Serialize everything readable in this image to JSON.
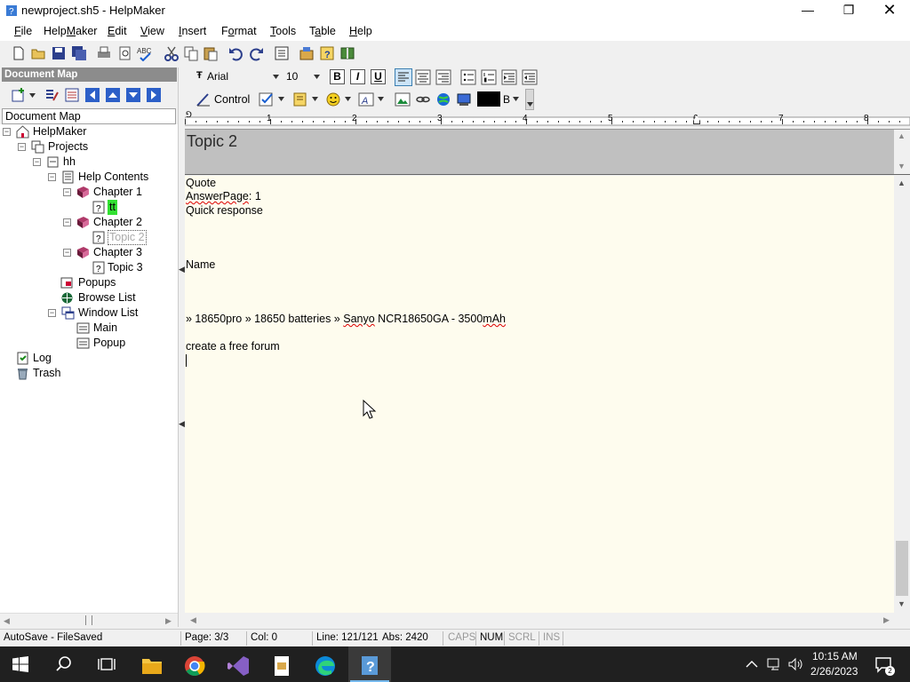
{
  "window": {
    "title": "newproject.sh5 - HelpMaker"
  },
  "menu": {
    "items": [
      {
        "pre": "",
        "acc": "F",
        "post": "ile"
      },
      {
        "pre": "Help",
        "acc": "M",
        "post": "aker"
      },
      {
        "pre": "",
        "acc": "E",
        "post": "dit"
      },
      {
        "pre": "",
        "acc": "V",
        "post": "iew"
      },
      {
        "pre": "",
        "acc": "I",
        "post": "nsert"
      },
      {
        "pre": "F",
        "acc": "o",
        "post": "rmat"
      },
      {
        "pre": "",
        "acc": "T",
        "post": "ools"
      },
      {
        "pre": "T",
        "acc": "a",
        "post": "ble"
      },
      {
        "pre": "",
        "acc": "H",
        "post": "elp"
      }
    ]
  },
  "docmap": {
    "header": "Document Map",
    "label": "Document Map"
  },
  "tree": {
    "helpmaker": "HelpMaker",
    "projects": "Projects",
    "hh": "hh",
    "help_contents": "Help Contents",
    "chapter1": "Chapter 1",
    "tt": "tt",
    "chapter2": "Chapter 2",
    "topic2": "Topic 2",
    "chapter3": "Chapter 3",
    "topic3": "Topic 3",
    "popups": "Popups",
    "browse_list": "Browse List",
    "window_list": "Window List",
    "main": "Main",
    "popup": "Popup",
    "log": "Log",
    "trash": "Trash"
  },
  "format": {
    "font": "Arial",
    "size": "10",
    "bold": "B",
    "italic": "I",
    "underline": "U",
    "control": "Control",
    "color_label": "B"
  },
  "ruler": {
    "marks": [
      "1",
      "2",
      "3",
      "4",
      "5",
      "6",
      "7",
      "8"
    ]
  },
  "topic": {
    "title": "Topic 2"
  },
  "editor": {
    "line1": "Quote",
    "line2_a": "AnswerPage",
    "line2_b": ": 1",
    "line3": "Quick response",
    "line4": "Name",
    "line5_a": "»  18650pro »  18650 batteries »  ",
    "line5_b": "Sanyo",
    "line5_c": " NCR18650GA - 3500",
    "line5_d": "mAh",
    "line6": "create a free forum"
  },
  "status": {
    "autosave": "AutoSave - FileSaved",
    "page": "Page: 3/3",
    "col": "Col: 0",
    "line": "Line: 121/121",
    "abs": "Abs: 2420",
    "caps": "CAPS",
    "num": "NUM",
    "scrl": "SCRL",
    "ins": "INS"
  },
  "taskbar": {
    "time": "10:15 AM",
    "date": "2/26/2023"
  },
  "colors": {
    "accent": "#0078d7",
    "editor_bg": "#fefcee",
    "taskbar": "#202020"
  }
}
